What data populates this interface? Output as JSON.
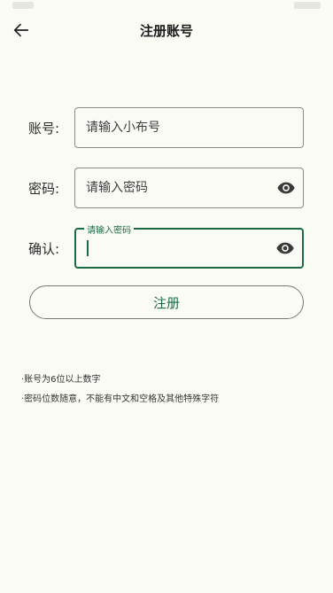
{
  "header": {
    "title": "注册账号",
    "back_icon": "arrow-left-icon"
  },
  "form": {
    "account": {
      "label": "账号:",
      "placeholder": "请输入小布号",
      "value": ""
    },
    "password": {
      "label": "密码:",
      "placeholder": "请输入密码",
      "value": "",
      "visibility_icon": "eye-icon"
    },
    "confirm": {
      "label": "确认:",
      "floating_label": "请输入密码",
      "value": "",
      "visibility_icon": "eye-icon",
      "focused": true
    }
  },
  "submit_label": "注册",
  "tips": [
    "·账号为6位以上数字",
    "·密码位数随意，不能有中文和空格及其他特殊字符"
  ],
  "colors": {
    "accent": "#1d6b44",
    "background": "#fbfbf6",
    "border": "#8a8a86"
  }
}
